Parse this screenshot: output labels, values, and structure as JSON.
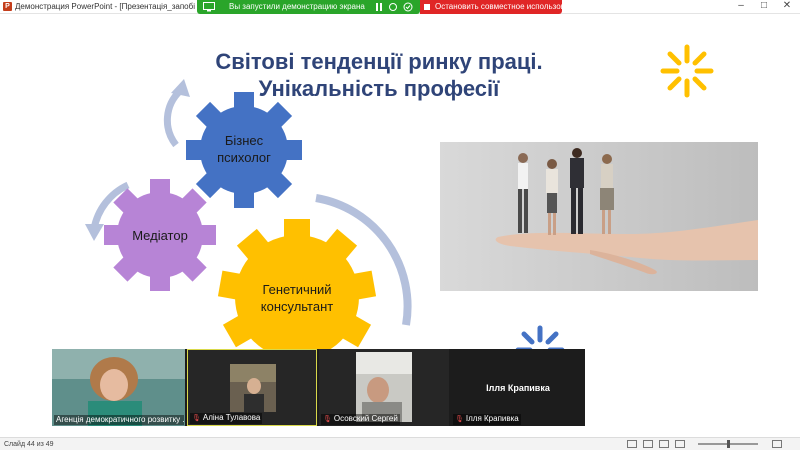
{
  "window": {
    "title": "Демонстрация PowerPoint - [Презентація_запобігання_ди",
    "minimize": "–",
    "maximize": "□",
    "close": "✕"
  },
  "share_banner": {
    "status": "Вы запустили демонстрацию экрана",
    "stop_label": "Остановить совместное использование",
    "color_green": "#2aa52a",
    "color_red": "#e02626"
  },
  "slide": {
    "title_line1": "Світові тенденції ринку праці.",
    "title_line2": "Унікальність професії",
    "title_color": "#2f4478",
    "gears": [
      {
        "label_line1": "Бізнес",
        "label_line2": "психолог",
        "color": "#4472c4"
      },
      {
        "label_line1": "Медіатор",
        "label_line2": "",
        "color": "#b784d6"
      },
      {
        "label_line1": "Генетичний",
        "label_line2": "консультант",
        "color": "#ffc000"
      }
    ]
  },
  "participants": [
    {
      "name": "Агенція демократичного розвитку ...",
      "muted": false,
      "type": "video-woman"
    },
    {
      "name": "Аліна Тулавова",
      "muted": true,
      "type": "video-small"
    },
    {
      "name": "Осовский Сергей",
      "muted": true,
      "type": "video-man"
    },
    {
      "name": "Ілля Крапивка",
      "muted": true,
      "type": "name-only",
      "display_name": "Ілля Крапивка"
    }
  ],
  "statusbar": {
    "slide_counter": "Слайд 44 из 49"
  }
}
